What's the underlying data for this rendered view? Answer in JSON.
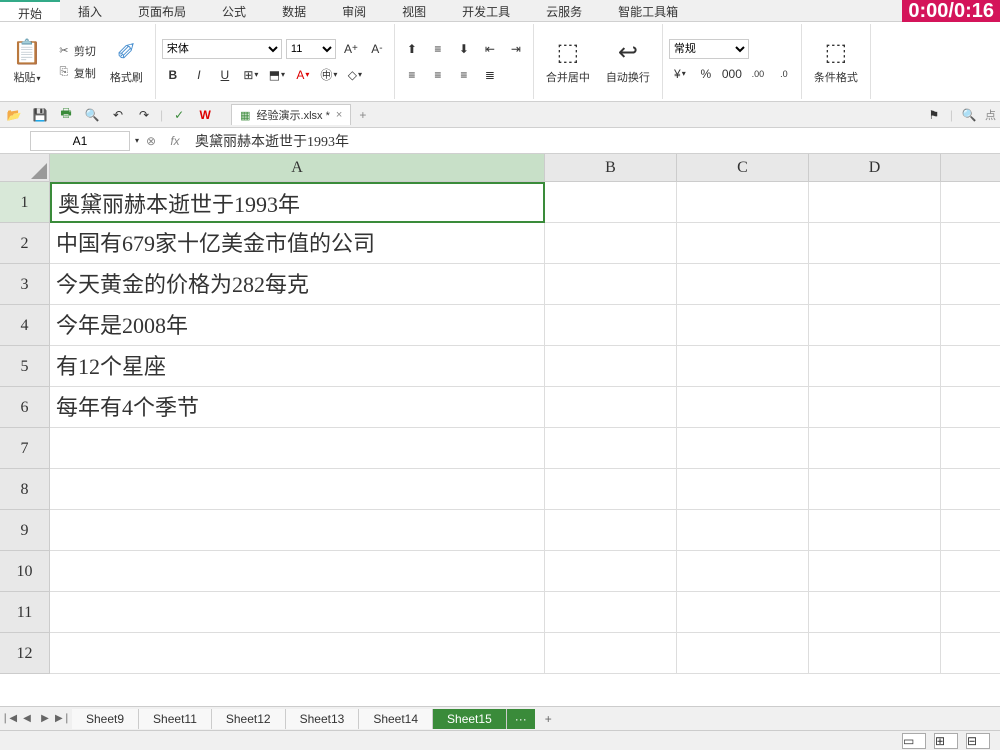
{
  "timer": "0:00/0:16",
  "menu": {
    "items": [
      "开始",
      "插入",
      "页面布局",
      "公式",
      "数据",
      "审阅",
      "视图",
      "开发工具",
      "云服务",
      "智能工具箱"
    ],
    "active_index": 0
  },
  "ribbon": {
    "paste": "粘贴",
    "cut": "剪切",
    "copy": "复制",
    "format_painter": "格式刷",
    "font_name": "宋体",
    "font_size": "11",
    "merge": "合并居中",
    "wrap": "自动换行",
    "number_format": "常规",
    "cond_format": "条件格式"
  },
  "doc_tab": {
    "name": "经验演示.xlsx *"
  },
  "cell_ref": "A1",
  "formula_value": "奥黛丽赫本逝世于1993年",
  "columns": [
    "A",
    "B",
    "C",
    "D"
  ],
  "rows": [
    {
      "n": "1",
      "A": "奥黛丽赫本逝世于1993年"
    },
    {
      "n": "2",
      "A": "中国有679家十亿美金市值的公司"
    },
    {
      "n": "3",
      "A": "今天黄金的价格为282每克"
    },
    {
      "n": "4",
      "A": "今年是2008年"
    },
    {
      "n": "5",
      "A": "有12个星座"
    },
    {
      "n": "6",
      "A": "每年有4个季节"
    },
    {
      "n": "7",
      "A": ""
    },
    {
      "n": "8",
      "A": ""
    },
    {
      "n": "9",
      "A": ""
    },
    {
      "n": "10",
      "A": ""
    },
    {
      "n": "11",
      "A": ""
    },
    {
      "n": "12",
      "A": ""
    }
  ],
  "sheets": [
    "Sheet9",
    "Sheet11",
    "Sheet12",
    "Sheet13",
    "Sheet14",
    "Sheet15"
  ],
  "active_sheet_index": 5,
  "icons": {
    "scissors": "✂",
    "paste": "📋",
    "brush": "🖌",
    "dd": "▾",
    "bold": "B",
    "italic": "I",
    "underline": "U",
    "plus": "+",
    "close": "×",
    "fx": "fx",
    "check": "✓",
    "first": "❘◀",
    "prev": "◀",
    "next": "▶",
    "last": "▶❘",
    "more": "···"
  }
}
